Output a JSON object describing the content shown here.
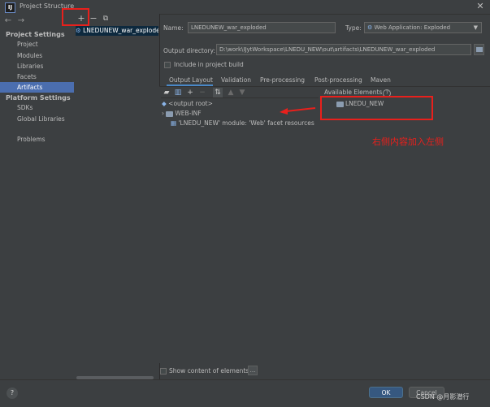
{
  "window": {
    "title": "Project Structure",
    "close_glyph": "✕",
    "app_icon_letter": "IJ"
  },
  "nav": {
    "back": "←",
    "forward": "→",
    "project_settings_title": "Project Settings",
    "project_settings": [
      "Project",
      "Modules",
      "Libraries",
      "Facets",
      "Artifacts"
    ],
    "platform_settings_title": "Platform Settings",
    "platform_settings": [
      "SDKs",
      "Global Libraries"
    ],
    "problems": "Problems",
    "selected": "Artifacts"
  },
  "artifacts_list": {
    "add": "+",
    "remove": "−",
    "copy": "⧉",
    "items": [
      "LNEDUNEW_war_exploded"
    ]
  },
  "form": {
    "name_label": "Name:",
    "name_value": "LNEDUNEW_war_exploded",
    "type_label": "Type:",
    "type_value": "Web Application: Exploded",
    "output_dir_label": "Output directory:",
    "output_dir_value": "D:\\work\\IJytWorkspace\\LNEDU_NEW\\out\\artifacts\\LNEDUNEW_war_exploded",
    "include_in_build": "Include in project build"
  },
  "tabs": [
    "Output Layout",
    "Validation",
    "Pre-processing",
    "Post-processing",
    "Maven"
  ],
  "active_tab": "Output Layout",
  "output_tree": {
    "root": "<output root>",
    "children": [
      "WEB-INF",
      "'LNEDU_NEW' module: 'Web' facet resources"
    ]
  },
  "available": {
    "label": "Available Elements",
    "help_glyph": "?",
    "items": [
      "LNEDU_NEW"
    ]
  },
  "annotation": {
    "text": "右侧内容加入左侧",
    "color": "#e8201c"
  },
  "show_content_label": "Show content of elements",
  "ellipsis": "...",
  "buttons": {
    "ok": "OK",
    "cancel": "Cancel",
    "help": "?"
  },
  "watermark": "CSDN @月影潜行",
  "colors": {
    "accent": "#4b6eaf",
    "background": "#3c3f41",
    "ok_button": "#365880"
  }
}
